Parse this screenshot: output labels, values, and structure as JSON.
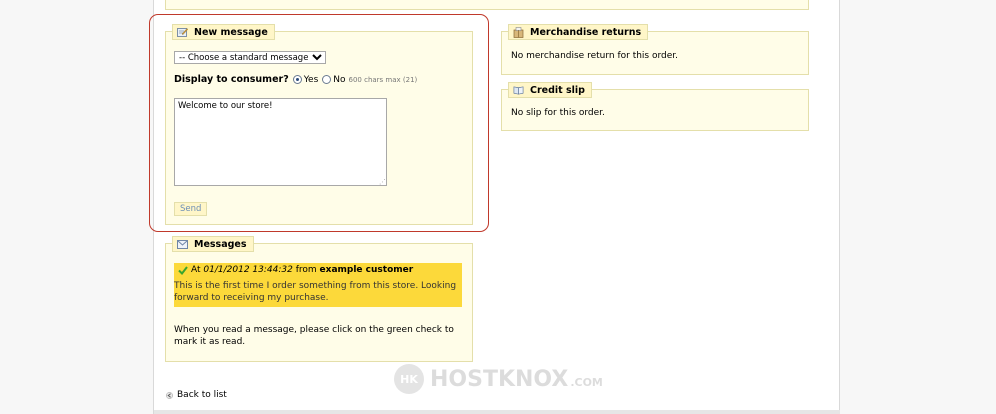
{
  "new_message": {
    "legend": "New message",
    "standard_select": "-- Choose a standard message --",
    "display_label": "Display to consumer?",
    "yes_label": "Yes",
    "no_label": "No",
    "chars_note": "600 chars max (21)",
    "textarea_value": "Welcome to our store!",
    "send_label": "Send"
  },
  "messages": {
    "legend": "Messages",
    "item": {
      "prefix": "At",
      "datetime": "01/1/2012 13:44:32",
      "from": "from",
      "author": "example customer",
      "body": "This is the first time I order something from this store. Looking forward to receiving my purchase."
    },
    "note": "When you read a message, please click on the green check to mark it as read."
  },
  "merchandise_returns": {
    "legend": "Merchandise returns",
    "text": "No merchandise return for this order."
  },
  "credit_slip": {
    "legend": "Credit slip",
    "text": "No slip for this order."
  },
  "back_link": "Back to list",
  "watermark": {
    "text": "HOSTKNOX",
    "suffix": ".COM"
  },
  "colors": {
    "panel_bg": "#fffde8",
    "panel_border": "#e4dfaa",
    "legend_bg": "#fff6c8",
    "message_highlight": "#fcd93a",
    "focus_frame": "#c0392b",
    "check_green": "#3aa52e"
  },
  "icons": {
    "new_message": "pencil-note-icon",
    "messages": "envelope-icon",
    "returns": "package-icon",
    "credit": "book-icon",
    "read_check": "check-icon",
    "back": "arrow-left-icon"
  }
}
